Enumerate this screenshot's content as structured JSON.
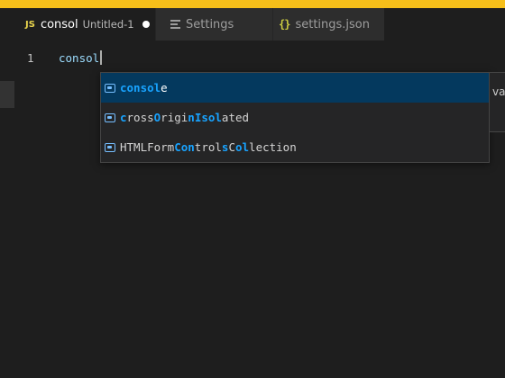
{
  "colors": {
    "top_accent": "#f6bf1a",
    "editor_bg": "#1e1e1e",
    "suggest_selected_bg": "#04395e",
    "match_highlight": "#18a3ff",
    "variable_icon": "#75beff"
  },
  "tabs": [
    {
      "icon_label": "JS",
      "icon": "javascript-icon",
      "title": "consol",
      "description": "Untitled-1",
      "dirty": true,
      "active": true
    },
    {
      "icon": "settings-icon",
      "title": "Settings",
      "active": false
    },
    {
      "icon_label": "{}",
      "icon": "json-braces-icon",
      "title": "settings.json",
      "active": false
    }
  ],
  "editor": {
    "line_number": "1",
    "code": "consol"
  },
  "suggestions": [
    {
      "icon": "variable-icon",
      "parts": [
        "consol",
        "e"
      ],
      "selected": true
    },
    {
      "icon": "variable-icon",
      "parts": [
        "c",
        "ross",
        "O",
        "rigi",
        "n",
        "",
        "I",
        "",
        "sol",
        "ated"
      ],
      "selected": false
    },
    {
      "icon": "variable-icon",
      "parts": [
        "",
        "HTMLForm",
        "Con",
        "trol",
        "s",
        "",
        "C",
        "",
        "o",
        "l",
        "l",
        "ection"
      ],
      "selected": false
    }
  ],
  "details_peek": "va"
}
